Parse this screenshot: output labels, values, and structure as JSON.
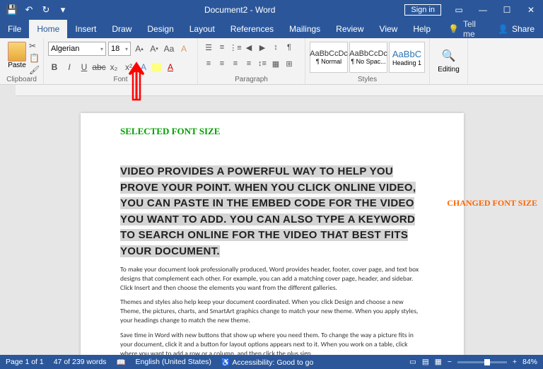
{
  "title": "Document2 - Word",
  "signin": "Sign in",
  "tabs": [
    "File",
    "Home",
    "Insert",
    "Draw",
    "Design",
    "Layout",
    "References",
    "Mailings",
    "Review",
    "View",
    "Help"
  ],
  "activeTab": "Home",
  "tellme": "Tell me",
  "share": "Share",
  "ribbon": {
    "clipboard": {
      "paste": "Paste",
      "title": "Clipboard"
    },
    "font": {
      "name": "Algerian",
      "size": "18",
      "title": "Font"
    },
    "paragraph": {
      "title": "Paragraph"
    },
    "styles": {
      "title": "Styles",
      "items": [
        {
          "preview": "AaBbCcDc",
          "name": "¶ Normal"
        },
        {
          "preview": "AaBbCcDc",
          "name": "¶ No Spac..."
        },
        {
          "preview": "AaBbC",
          "name": "Heading 1"
        }
      ]
    },
    "editing": {
      "title": "Editing"
    }
  },
  "annotations": {
    "top": "SELECTED FONT SIZE",
    "side": "CHANGED FONT SIZE"
  },
  "doc": {
    "bigtext": "Video provides a powerful way to help you prove your point. When you click Online Video, you can paste in the embed code for the video you want to add. You can also type a keyword to search online for the video that best fits your document.",
    "p1": "To make your document look professionally produced, Word provides header, footer, cover page, and text box designs that complement each other. For example, you can add a matching cover page, header, and sidebar. Click Insert and then choose the elements you want from the different galleries.",
    "p2": "Themes and styles also help keep your document coordinated. When you click Design and choose a new Theme, the pictures, charts, and SmartArt graphics change to match your new theme. When you apply styles, your headings change to match the new theme.",
    "p3": "Save time in Word with new buttons that show up where you need them. To change the way a picture fits in your document, click it and a button for layout options appears next to it. When you work on a table, click where you want to add a row or a column, and then click the plus sign."
  },
  "status": {
    "page": "Page 1 of 1",
    "words": "47 of 239 words",
    "lang": "English (United States)",
    "access": "Accessibility: Good to go",
    "zoom": "84%"
  }
}
